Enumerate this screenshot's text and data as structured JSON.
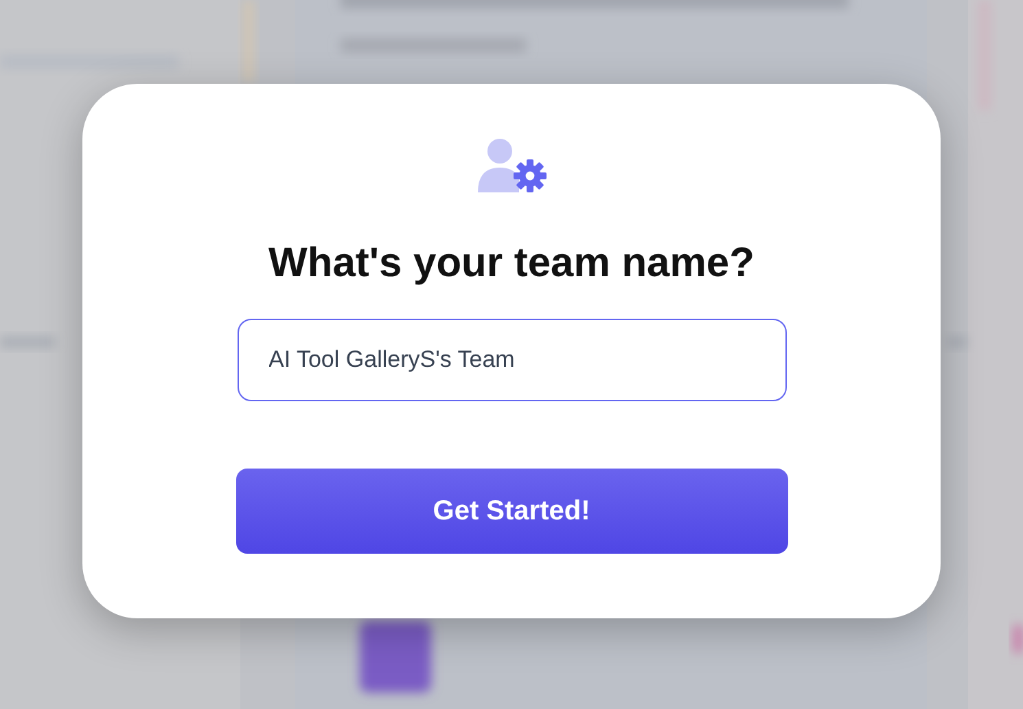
{
  "dialog": {
    "title": "What's your team name?",
    "team_name_field": {
      "value": "AI Tool GalleryS's Team"
    },
    "submit_button": {
      "label": "Get Started!"
    }
  }
}
